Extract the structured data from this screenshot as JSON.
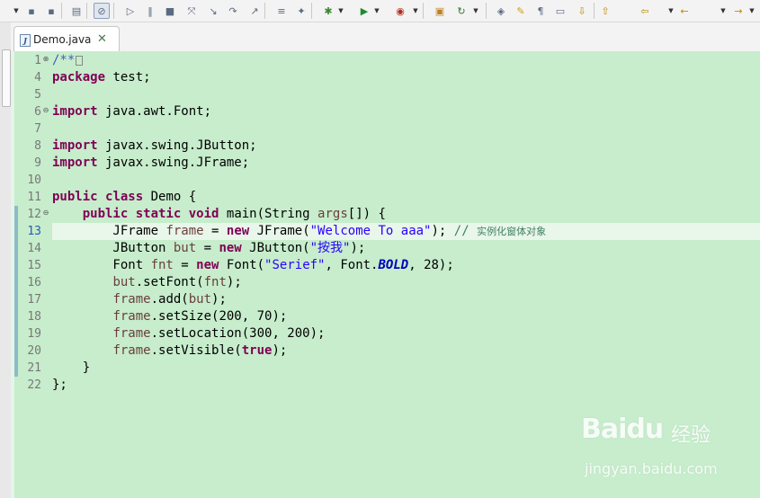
{
  "tab": {
    "name": "Demo.java",
    "close_symbol": "✕"
  },
  "toolbar": {
    "icons": [
      "save-icon",
      "save-all-icon",
      "print-icon",
      "skip-breakpoints-icon",
      "resume-icon",
      "suspend-icon",
      "terminate-icon",
      "disconnect-icon",
      "step-into-icon",
      "step-over-icon",
      "step-return-icon",
      "toggle-task-icon",
      "new-java-project-icon",
      "debug-icon",
      "run-icon",
      "external-tools-icon",
      "open-type-icon",
      "refresh-icon",
      "toggle-mark-occurrences-icon",
      "toggle-highlight-icon",
      "show-whitespace-icon",
      "block-selection-icon",
      "next-annotation-icon",
      "previous-annotation-icon",
      "last-edit-icon",
      "back-icon",
      "forward-icon"
    ]
  },
  "editor": {
    "current_line": 13,
    "lines": [
      {
        "n": "1",
        "fold": "plus",
        "tokens": [
          {
            "t": "/**",
            "c": "jd"
          }
        ],
        "collapsed": true
      },
      {
        "n": "4",
        "tokens": [
          {
            "t": "package",
            "c": "kw"
          },
          {
            "t": " test;",
            "c": ""
          }
        ]
      },
      {
        "n": "5",
        "tokens": []
      },
      {
        "n": "6",
        "fold": "minus",
        "tokens": [
          {
            "t": "import",
            "c": "kw"
          },
          {
            "t": " java.awt.Font;",
            "c": ""
          }
        ]
      },
      {
        "n": "7",
        "tokens": []
      },
      {
        "n": "8",
        "tokens": [
          {
            "t": "import",
            "c": "kw"
          },
          {
            "t": " javax.swing.JButton;",
            "c": ""
          }
        ]
      },
      {
        "n": "9",
        "tokens": [
          {
            "t": "import",
            "c": "kw"
          },
          {
            "t": " javax.swing.JFrame;",
            "c": ""
          }
        ]
      },
      {
        "n": "10",
        "tokens": []
      },
      {
        "n": "11",
        "tokens": [
          {
            "t": "public",
            "c": "kw"
          },
          {
            "t": " ",
            "c": ""
          },
          {
            "t": "class",
            "c": "kw"
          },
          {
            "t": " Demo {",
            "c": ""
          }
        ]
      },
      {
        "n": "12",
        "fold": "minus",
        "tokens": [
          {
            "t": "    ",
            "c": ""
          },
          {
            "t": "public",
            "c": "kw"
          },
          {
            "t": " ",
            "c": ""
          },
          {
            "t": "static",
            "c": "kw"
          },
          {
            "t": " ",
            "c": ""
          },
          {
            "t": "void",
            "c": "kw"
          },
          {
            "t": " main(String ",
            "c": ""
          },
          {
            "t": "args",
            "c": "var"
          },
          {
            "t": "[]) {",
            "c": ""
          }
        ]
      },
      {
        "n": "13",
        "tokens": [
          {
            "t": "        JFrame ",
            "c": ""
          },
          {
            "t": "frame",
            "c": "var"
          },
          {
            "t": " = ",
            "c": ""
          },
          {
            "t": "new",
            "c": "kw"
          },
          {
            "t": " JFrame(",
            "c": ""
          },
          {
            "t": "\"Welcome To aaa\"",
            "c": "str"
          },
          {
            "t": "); ",
            "c": ""
          },
          {
            "t": "// ",
            "c": "cm"
          },
          {
            "t": "实例化窗体对象",
            "c": "cm-text"
          }
        ]
      },
      {
        "n": "14",
        "tokens": [
          {
            "t": "        JButton ",
            "c": ""
          },
          {
            "t": "but",
            "c": "var"
          },
          {
            "t": " = ",
            "c": ""
          },
          {
            "t": "new",
            "c": "kw"
          },
          {
            "t": " JButton(",
            "c": ""
          },
          {
            "t": "\"按我\"",
            "c": "str"
          },
          {
            "t": ");",
            "c": ""
          }
        ]
      },
      {
        "n": "15",
        "tokens": [
          {
            "t": "        Font ",
            "c": ""
          },
          {
            "t": "fnt",
            "c": "var"
          },
          {
            "t": " = ",
            "c": ""
          },
          {
            "t": "new",
            "c": "kw"
          },
          {
            "t": " Font(",
            "c": ""
          },
          {
            "t": "\"Serief\"",
            "c": "str"
          },
          {
            "t": ", Font.",
            "c": ""
          },
          {
            "t": "BOLD",
            "c": "sfld"
          },
          {
            "t": ", 28);",
            "c": ""
          }
        ]
      },
      {
        "n": "16",
        "tokens": [
          {
            "t": "        ",
            "c": ""
          },
          {
            "t": "but",
            "c": "var"
          },
          {
            "t": ".setFont(",
            "c": ""
          },
          {
            "t": "fnt",
            "c": "var"
          },
          {
            "t": ");",
            "c": ""
          }
        ]
      },
      {
        "n": "17",
        "tokens": [
          {
            "t": "        ",
            "c": ""
          },
          {
            "t": "frame",
            "c": "var"
          },
          {
            "t": ".add(",
            "c": ""
          },
          {
            "t": "but",
            "c": "var"
          },
          {
            "t": ");",
            "c": ""
          }
        ]
      },
      {
        "n": "18",
        "tokens": [
          {
            "t": "        ",
            "c": ""
          },
          {
            "t": "frame",
            "c": "var"
          },
          {
            "t": ".setSize(200, 70);",
            "c": ""
          }
        ]
      },
      {
        "n": "19",
        "tokens": [
          {
            "t": "        ",
            "c": ""
          },
          {
            "t": "frame",
            "c": "var"
          },
          {
            "t": ".setLocation(300, 200);",
            "c": ""
          }
        ]
      },
      {
        "n": "20",
        "tokens": [
          {
            "t": "        ",
            "c": ""
          },
          {
            "t": "frame",
            "c": "var"
          },
          {
            "t": ".setVisible(",
            "c": ""
          },
          {
            "t": "true",
            "c": "kw"
          },
          {
            "t": ");",
            "c": ""
          }
        ]
      },
      {
        "n": "21",
        "tokens": [
          {
            "t": "    }",
            "c": ""
          }
        ]
      },
      {
        "n": "22",
        "tokens": [
          {
            "t": "};",
            "c": ""
          }
        ]
      }
    ]
  },
  "watermark": {
    "brand": "Baidu",
    "sub": "经验",
    "url": "jingyan.baidu.com"
  },
  "colors": {
    "editor_bg": "#c7edcc",
    "keyword": "#7f0055",
    "string": "#2a00ff",
    "local_var": "#6a3e3e",
    "comment": "#3f7f5f"
  }
}
